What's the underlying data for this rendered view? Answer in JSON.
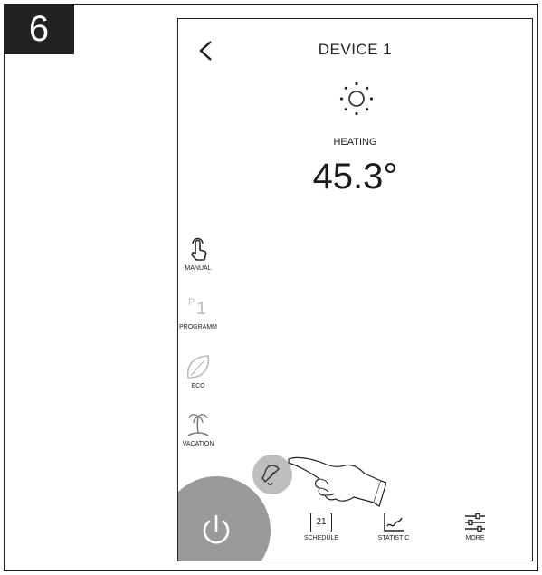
{
  "step": {
    "number": "6"
  },
  "header": {
    "title": "DEVICE 1",
    "back_icon": "back-chevron-icon"
  },
  "status": {
    "icon": "sun-icon",
    "state": "HEATING",
    "temperature": "45.3°"
  },
  "modes": [
    {
      "label": "MANUAL",
      "icon": "hand-touch-icon",
      "active": true
    },
    {
      "label": "PROGRAMM",
      "icon": "program-p1-icon",
      "active": false
    },
    {
      "label": "ECO",
      "icon": "leaf-icon",
      "active": false
    },
    {
      "label": "VACATION",
      "icon": "palm-island-icon",
      "active": false
    }
  ],
  "program_glyph": {
    "letter": "P",
    "digit": "1"
  },
  "bottom_bar": {
    "power_icon": "power-icon",
    "bell_icon": "bell-icon",
    "tabs": [
      {
        "label": "SCHEDULE",
        "icon": "calendar-icon",
        "calendar_day": "21"
      },
      {
        "label": "STATISTIC",
        "icon": "chart-icon"
      },
      {
        "label": "MORE",
        "icon": "sliders-icon"
      }
    ]
  },
  "colors": {
    "power_bg": "#9a9a9a",
    "bell_bg": "#bdbdbd",
    "inactive": "#bbbbbb",
    "ink": "#222222"
  }
}
